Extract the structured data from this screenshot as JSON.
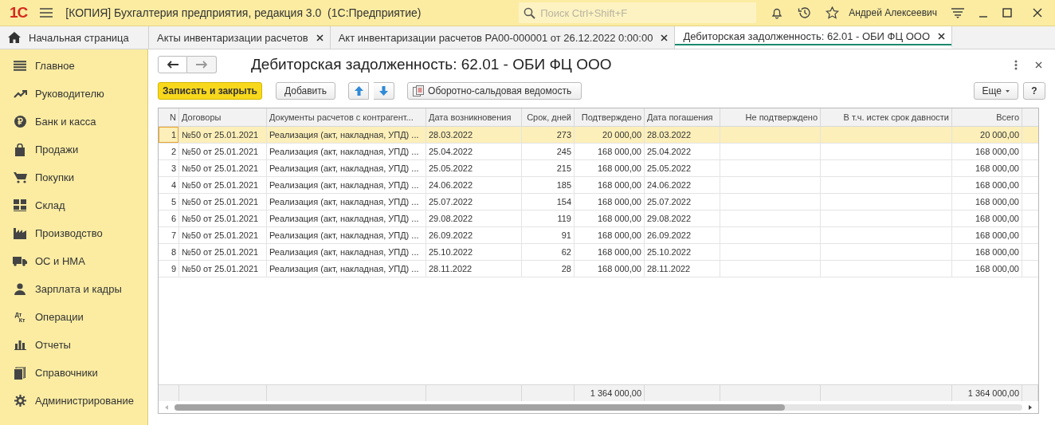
{
  "app_bar": {
    "logo": "1С",
    "title": "[КОПИЯ] Бухгалтерия предприятия, редакция 3.0  (1С:Предприятие)",
    "search": {
      "placeholder": "Поиск Ctrl+Shift+F"
    },
    "user": "Андрей Алексеевич"
  },
  "tabs": [
    {
      "label": "Начальная страница",
      "kind": "home",
      "selected": false
    },
    {
      "label": "Акты инвентаризации расчетов",
      "kind": "doc",
      "selected": false
    },
    {
      "label": "Акт инвентаризации расчетов РА00-000001 от 26.12.2022 0:00:00",
      "kind": "doc",
      "selected": false
    },
    {
      "label": "Дебиторская задолженность: 62.01 - ОБИ ФЦ ООО",
      "kind": "doc",
      "selected": true
    }
  ],
  "sidebar": {
    "items": [
      {
        "label": "Главное"
      },
      {
        "label": "Руководителю"
      },
      {
        "label": "Банк и касса"
      },
      {
        "label": "Продажи"
      },
      {
        "label": "Покупки"
      },
      {
        "label": "Склад"
      },
      {
        "label": "Производство"
      },
      {
        "label": "ОС и НМА"
      },
      {
        "label": "Зарплата и кадры"
      },
      {
        "label": "Операции",
        "icon_top": "Дт",
        "icon_bottom": "Кт"
      },
      {
        "label": "Отчеты"
      },
      {
        "label": "Справочники"
      },
      {
        "label": "Администрирование"
      }
    ]
  },
  "form": {
    "title": "Дебиторская задолженность: 62.01 - ОБИ ФЦ ООО",
    "toolbar": {
      "save_close": "Записать и закрыть",
      "add": "Добавить",
      "report": "Оборотно-сальдовая ведомость",
      "more": "Еще",
      "help": "?"
    },
    "table": {
      "columns": [
        "N",
        "Договоры",
        "Документы расчетов с контрагент...",
        "Дата возникновения",
        "Срок, дней",
        "Подтверждено",
        "Дата погашения",
        "Не подтверждено",
        "В т.ч. истек срок давности",
        "Всего"
      ],
      "rows": [
        {
          "n": "1",
          "contract": "№50 от 25.01.2021",
          "document": "Реализация (акт, накладная, УПД) ...",
          "date_origin": "28.03.2022",
          "days": "273",
          "confirmed": "20 000,00",
          "date_repayment": "28.03.2022",
          "total": "20 000,00",
          "selected": true
        },
        {
          "n": "2",
          "contract": "№50 от 25.01.2021",
          "document": "Реализация (акт, накладная, УПД) ...",
          "date_origin": "25.04.2022",
          "days": "245",
          "confirmed": "168 000,00",
          "date_repayment": "25.04.2022",
          "total": "168 000,00",
          "selected": false
        },
        {
          "n": "3",
          "contract": "№50 от 25.01.2021",
          "document": "Реализация (акт, накладная, УПД) ...",
          "date_origin": "25.05.2022",
          "days": "215",
          "confirmed": "168 000,00",
          "date_repayment": "25.05.2022",
          "total": "168 000,00",
          "selected": false
        },
        {
          "n": "4",
          "contract": "№50 от 25.01.2021",
          "document": "Реализация (акт, накладная, УПД) ...",
          "date_origin": "24.06.2022",
          "days": "185",
          "confirmed": "168 000,00",
          "date_repayment": "24.06.2022",
          "total": "168 000,00",
          "selected": false
        },
        {
          "n": "5",
          "contract": "№50 от 25.01.2021",
          "document": "Реализация (акт, накладная, УПД) ...",
          "date_origin": "25.07.2022",
          "days": "154",
          "confirmed": "168 000,00",
          "date_repayment": "25.07.2022",
          "total": "168 000,00",
          "selected": false
        },
        {
          "n": "6",
          "contract": "№50 от 25.01.2021",
          "document": "Реализация (акт, накладная, УПД) ...",
          "date_origin": "29.08.2022",
          "days": "119",
          "confirmed": "168 000,00",
          "date_repayment": "29.08.2022",
          "total": "168 000,00",
          "selected": false
        },
        {
          "n": "7",
          "contract": "№50 от 25.01.2021",
          "document": "Реализация (акт, накладная, УПД) ...",
          "date_origin": "26.09.2022",
          "days": "91",
          "confirmed": "168 000,00",
          "date_repayment": "26.09.2022",
          "total": "168 000,00",
          "selected": false
        },
        {
          "n": "8",
          "contract": "№50 от 25.01.2021",
          "document": "Реализация (акт, накладная, УПД) ...",
          "date_origin": "25.10.2022",
          "days": "62",
          "confirmed": "168 000,00",
          "date_repayment": "25.10.2022",
          "total": "168 000,00",
          "selected": false
        },
        {
          "n": "9",
          "contract": "№50 от 25.01.2021",
          "document": "Реализация (акт, накладная, УПД) ...",
          "date_origin": "28.11.2022",
          "days": "28",
          "confirmed": "168 000,00",
          "date_repayment": "28.11.2022",
          "total": "168 000,00",
          "selected": false
        }
      ],
      "footer": {
        "confirmed": "1 364 000,00",
        "total": "1 364 000,00"
      }
    }
  }
}
